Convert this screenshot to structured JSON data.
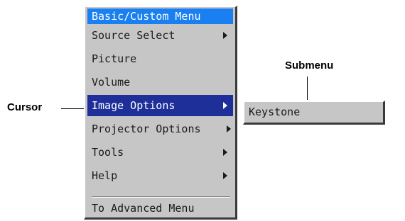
{
  "menu": {
    "title": "Basic/Custom Menu",
    "items": [
      {
        "label": "Source Select",
        "has_submenu": true
      },
      {
        "label": "Picture",
        "has_submenu": false
      },
      {
        "label": "Volume",
        "has_submenu": false
      },
      {
        "label": "Image Options",
        "has_submenu": true,
        "selected": true
      },
      {
        "label": "Projector Options",
        "has_submenu": true
      },
      {
        "label": "Tools",
        "has_submenu": true
      },
      {
        "label": "Help",
        "has_submenu": true
      },
      {
        "label": "To Advanced Menu",
        "has_submenu": false
      }
    ]
  },
  "submenu": {
    "items": [
      {
        "label": "Keystone"
      }
    ]
  },
  "annotations": {
    "cursor_label": "Cursor",
    "submenu_label": "Submenu"
  },
  "colors": {
    "menu_background": "#c6c6c6",
    "title_bar": "#1a7ff0",
    "selected_row": "#1f2f9a",
    "text": "#1a1a1a"
  }
}
